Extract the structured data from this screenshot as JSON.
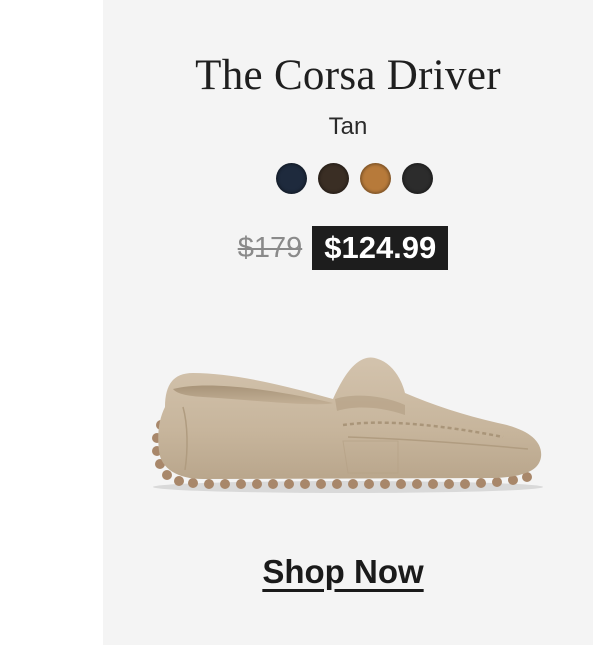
{
  "product": {
    "title": "The Corsa Driver",
    "color_name": "Tan",
    "swatches": [
      {
        "name": "navy",
        "color": "#1e2a3d"
      },
      {
        "name": "dark-brown",
        "color": "#3a2e24"
      },
      {
        "name": "tan",
        "color": "#b77a3a"
      },
      {
        "name": "black",
        "color": "#2c2c2c"
      }
    ],
    "price_original": "$179",
    "price_sale": "$124.99",
    "image_icon": "suede-loafer-driver-shoe"
  },
  "cta": {
    "label": "Shop Now"
  }
}
